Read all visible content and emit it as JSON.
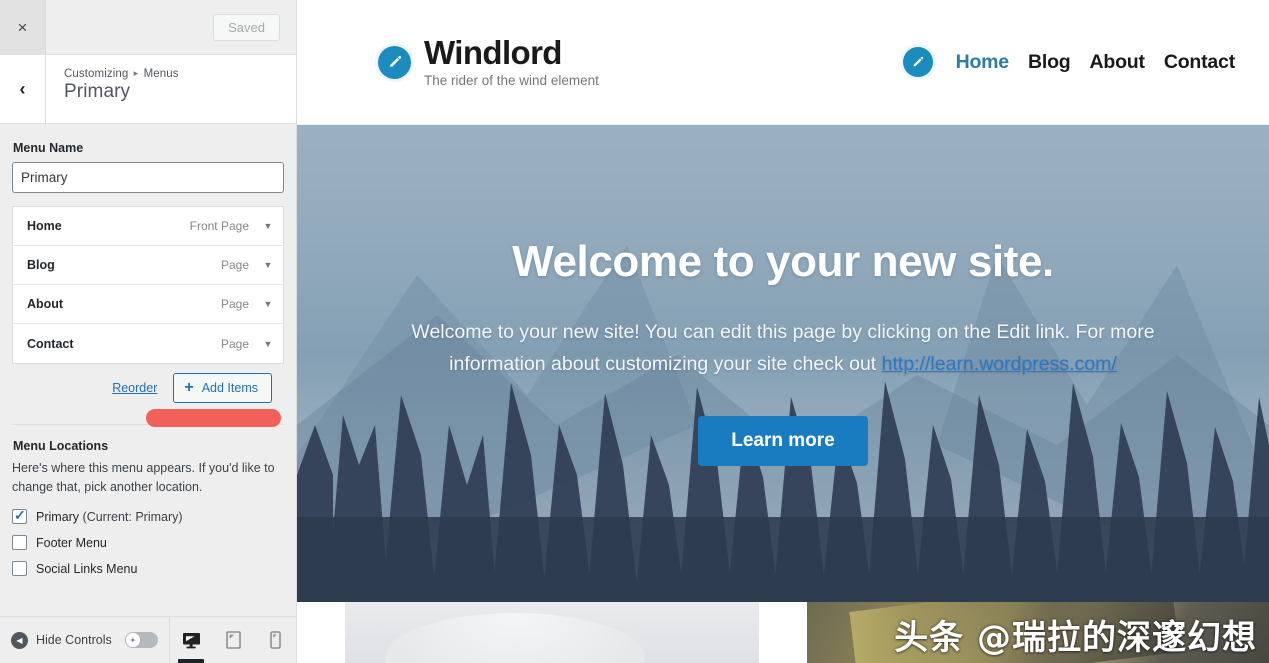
{
  "customizer": {
    "close_label": "×",
    "saved_label": "Saved",
    "back_label": "‹",
    "breadcrumb_prefix": "Customizing",
    "breadcrumb_separator": "▸",
    "breadcrumb_current": "Menus",
    "panel_title": "Primary",
    "menu_name_label": "Menu Name",
    "menu_name_value": "Primary",
    "menu_items": [
      {
        "name": "Home",
        "type": "Front Page",
        "caret": "▼"
      },
      {
        "name": "Blog",
        "type": "Page",
        "caret": "▼"
      },
      {
        "name": "About",
        "type": "Page",
        "caret": "▼"
      },
      {
        "name": "Contact",
        "type": "Page",
        "caret": "▼"
      }
    ],
    "reorder_label": "Reorder",
    "add_items_label": "Add Items",
    "add_items_plus": "+",
    "locations_title": "Menu Locations",
    "locations_desc": "Here's where this menu appears. If you'd like to change that, pick another location.",
    "locations": [
      {
        "label": "Primary",
        "note": " (Current: Primary)",
        "checked": true
      },
      {
        "label": "Footer Menu",
        "note": "",
        "checked": false
      },
      {
        "label": "Social Links Menu",
        "note": "",
        "checked": false
      }
    ],
    "hide_controls_label": "Hide Controls",
    "collapse_icon": "◀",
    "toggle_icon": "✦",
    "devices": [
      {
        "name": "desktop-preview",
        "active": true
      },
      {
        "name": "tablet-preview",
        "active": false
      },
      {
        "name": "mobile-preview",
        "active": false
      }
    ],
    "accent_color": "#2271b1",
    "annotation_color": "#f2554f"
  },
  "preview": {
    "site_title": "Windlord",
    "tagline": "The rider of the wind element",
    "logo_icon": "pencil-icon",
    "nav": [
      {
        "label": "Home",
        "active": true
      },
      {
        "label": "Blog",
        "active": false
      },
      {
        "label": "About",
        "active": false
      },
      {
        "label": "Contact",
        "active": false
      }
    ],
    "hero": {
      "title": "Welcome to your new site.",
      "body_before": "Welcome to your new site! You can edit this page by clicking on the Edit link. For more information about customizing your site check out ",
      "link_text": "http://learn.wordpress.com/",
      "button_label": "Learn more"
    },
    "watermark": "头条 @瑞拉的深邃幻想",
    "brand_color": "#1b8cbe",
    "link_color": "#2f76c4",
    "button_color": "#1a7cc0"
  }
}
